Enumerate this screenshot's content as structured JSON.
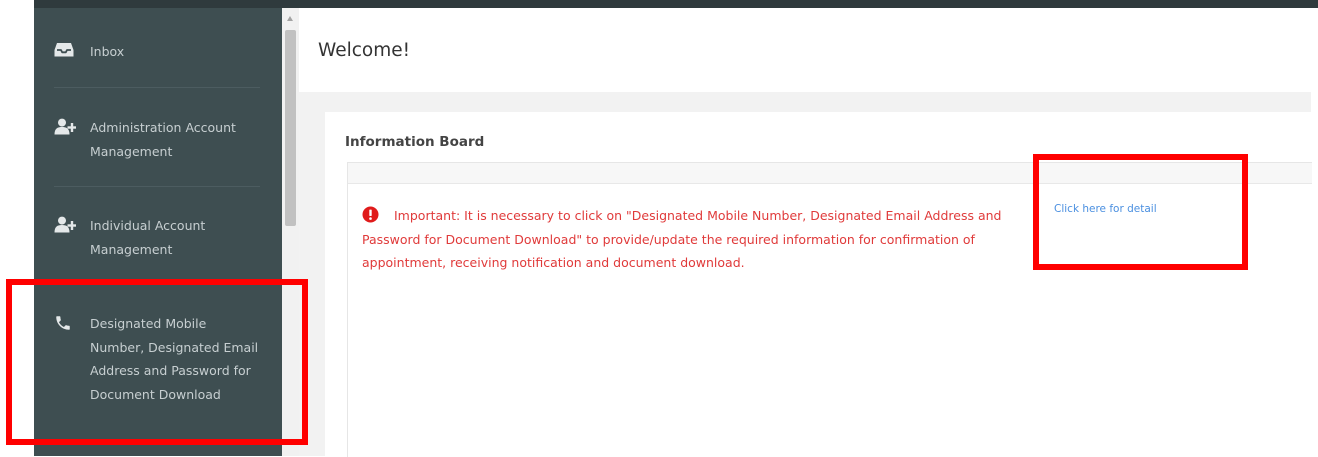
{
  "sidebar": {
    "items": [
      {
        "label": "Inbox",
        "icon": "inbox-icon"
      },
      {
        "label": "Administration Account Management",
        "icon": "add-user-icon"
      },
      {
        "label": "Individual Account Management",
        "icon": "add-user-icon"
      },
      {
        "label": "Designated Mobile Number, Designated Email Address and Password for Document Download",
        "icon": "phone-icon"
      }
    ]
  },
  "header": {
    "title": "Welcome!"
  },
  "board": {
    "title": "Information Board",
    "notice": "Important: It is necessary to click on \"Designated Mobile Number, Designated Email Address and Password for Document Download\" to provide/update the required information for confirmation of appointment, receiving notification and document download.",
    "notice_icon": "exclamation-circle-icon",
    "link": "Click here for detail"
  },
  "colors": {
    "sidebar_bg": "#3e4e51",
    "notice_text": "#e03a3a",
    "link": "#4a8fe0",
    "highlight": "#ff0000"
  }
}
